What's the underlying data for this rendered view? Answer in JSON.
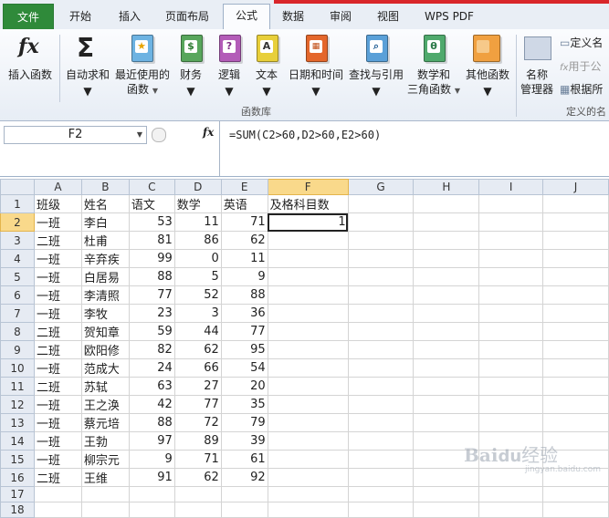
{
  "tabs": [
    {
      "label": "文件",
      "key": "file"
    },
    {
      "label": "开始",
      "key": "home"
    },
    {
      "label": "插入",
      "key": "insert"
    },
    {
      "label": "页面布局",
      "key": "layout"
    },
    {
      "label": "公式",
      "key": "formulas"
    },
    {
      "label": "数据",
      "key": "data"
    },
    {
      "label": "审阅",
      "key": "review"
    },
    {
      "label": "视图",
      "key": "view"
    },
    {
      "label": "WPS PDF",
      "key": "wpspdf"
    }
  ],
  "ribbon": {
    "insert_function": "插入函数",
    "autosum": "自动求和",
    "recent_line1": "最近使用的",
    "recent_line2": "函数",
    "financial": "财务",
    "logical": "逻辑",
    "text": "文本",
    "datetime": "日期和时间",
    "lookup": "查找与引用",
    "math_line1": "数学和",
    "math_line2": "三角函数",
    "other": "其他函数",
    "group_label": "函数库",
    "name_mgr_line1": "名称",
    "name_mgr_line2": "管理器",
    "define_name": "定义名",
    "use_in_formula": "用于公",
    "create_from_sel": "根据所",
    "defined_names_group": "定义的名",
    "icon_financial": "$",
    "icon_logical": "?",
    "icon_text": "A",
    "icon_math": "θ"
  },
  "formula_bar": {
    "name_box": "F2",
    "fx": "fx",
    "formula": "=SUM(C2>60,D2>60,E2>60)"
  },
  "sheet": {
    "columns": [
      "A",
      "B",
      "C",
      "D",
      "E",
      "F",
      "G",
      "H",
      "I",
      "J"
    ],
    "rows": [
      [
        "班级",
        "姓名",
        "语文",
        "数学",
        "英语",
        "及格科目数"
      ],
      [
        "一班",
        "李白",
        "53",
        "11",
        "71",
        "1"
      ],
      [
        "二班",
        "杜甫",
        "81",
        "86",
        "62",
        ""
      ],
      [
        "一班",
        "辛弃疾",
        "99",
        "0",
        "11",
        ""
      ],
      [
        "一班",
        "白居易",
        "88",
        "5",
        "9",
        ""
      ],
      [
        "一班",
        "李清照",
        "77",
        "52",
        "88",
        ""
      ],
      [
        "一班",
        "李牧",
        "23",
        "3",
        "36",
        ""
      ],
      [
        "二班",
        "贺知章",
        "59",
        "44",
        "77",
        ""
      ],
      [
        "二班",
        "欧阳修",
        "82",
        "62",
        "95",
        ""
      ],
      [
        "一班",
        "范成大",
        "24",
        "66",
        "54",
        ""
      ],
      [
        "二班",
        "苏轼",
        "63",
        "27",
        "20",
        ""
      ],
      [
        "一班",
        "王之涣",
        "42",
        "77",
        "35",
        ""
      ],
      [
        "一班",
        "蔡元培",
        "88",
        "72",
        "79",
        ""
      ],
      [
        "一班",
        "王勃",
        "97",
        "89",
        "39",
        ""
      ],
      [
        "一班",
        "柳宗元",
        "9",
        "71",
        "61",
        ""
      ],
      [
        "二班",
        "王维",
        "91",
        "62",
        "92",
        ""
      ],
      [
        "",
        "",
        "",
        "",
        "",
        ""
      ],
      [
        "",
        "",
        "",
        "",
        "",
        ""
      ]
    ]
  },
  "watermark": {
    "brand": "Bai",
    "paw": "du",
    "site": "经验",
    "url": "jingyan.baidu.com"
  }
}
